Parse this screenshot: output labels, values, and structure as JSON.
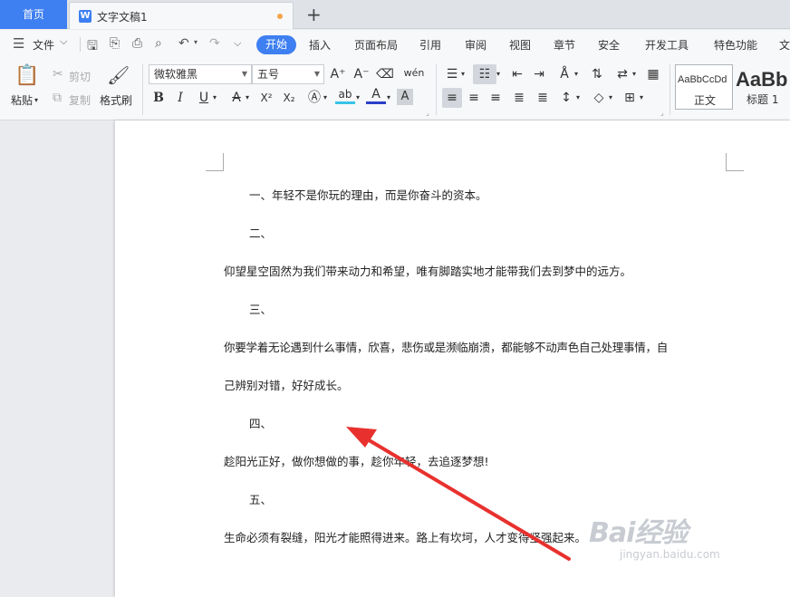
{
  "tabs": {
    "home": "首页",
    "doc_title": "文字文稿1",
    "add": "+"
  },
  "menu": {
    "file": "文件",
    "items": [
      "开始",
      "插入",
      "页面布局",
      "引用",
      "审阅",
      "视图",
      "章节",
      "安全",
      "开发工具",
      "特色功能",
      "文"
    ]
  },
  "toolbar": {
    "paste": "粘贴",
    "cut": "剪切",
    "copy": "复制",
    "format_painter": "格式刷",
    "font_name": "微软雅黑",
    "font_size": "五号",
    "bold": "B",
    "italic": "I",
    "underline": "U",
    "strike": "A",
    "superscript": "X²",
    "subscript": "X₂",
    "font_color": "A",
    "char_shading": "A",
    "highlight": "ab",
    "grow": "A⁺",
    "shrink": "A⁻",
    "pinyin": "wén",
    "styles": [
      {
        "sample": "AaBbCcDd",
        "name": "正文"
      },
      {
        "sample": "AaBb",
        "name": "标题 1"
      }
    ]
  },
  "document": {
    "paragraphs": [
      "一、年轻不是你玩的理由，而是你奋斗的资本。",
      "二、",
      "仰望星空固然为我们带来动力和希望，唯有脚踏实地才能带我们去到梦中的远方。",
      "三、",
      "你要学着无论遇到什么事情，欣喜，悲伤或是濒临崩溃，都能够不动声色自己处理事情，自",
      "己辨别对错，好好成长。",
      "四、",
      "趁阳光正好，做你想做的事，趁你年轻，去追逐梦想!",
      "五、",
      "生命必须有裂缝，阳光才能照得进来。路上有坎坷，人才变得坚强起来。"
    ]
  },
  "watermark": {
    "brand": "Bai经验",
    "url": "jingyan.baidu.com"
  },
  "colors": {
    "accent": "#3e7ff1",
    "arrow": "#e8312e"
  }
}
